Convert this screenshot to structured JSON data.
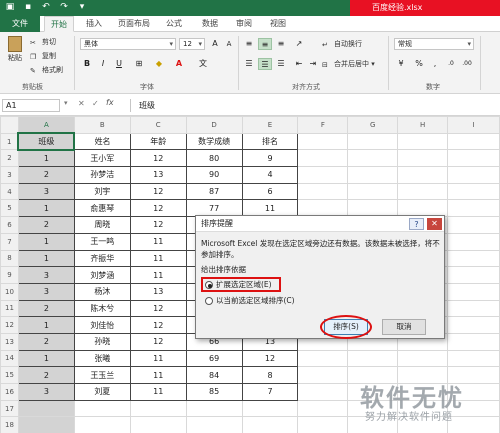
{
  "titlebar": {
    "doc_title": "百度经验.xlsx"
  },
  "tabs": [
    "文件",
    "开始",
    "插入",
    "页面布局",
    "公式",
    "数据",
    "审阅",
    "视图"
  ],
  "ribbon": {
    "clipboard": {
      "paste": "粘贴",
      "cut": "剪切",
      "copy": "复制",
      "format_painter": "格式刷",
      "label": "剪贴板"
    },
    "font": {
      "name": "黑体",
      "size": "12",
      "bold": "B",
      "italic": "I",
      "underline": "U",
      "label": "字体"
    },
    "alignment": {
      "wrap": "自动换行",
      "merge": "合并后居中",
      "label": "对齐方式"
    },
    "number": {
      "format": "常规",
      "label": "数字"
    }
  },
  "formula_bar": {
    "cell_ref": "A1",
    "fx": "fx",
    "content": "班级"
  },
  "columns": [
    "A",
    "B",
    "C",
    "D",
    "E",
    "F",
    "G",
    "H",
    "I"
  ],
  "headers": [
    "班级",
    "姓名",
    "年龄",
    "数学成绩",
    "排名"
  ],
  "rows": [
    [
      "1",
      "王小军",
      "12",
      "80",
      "9"
    ],
    [
      "2",
      "孙梦洁",
      "13",
      "90",
      "4"
    ],
    [
      "3",
      "刘宇",
      "12",
      "87",
      "6"
    ],
    [
      "1",
      "俞惠琴",
      "12",
      "77",
      "11"
    ],
    [
      "2",
      "周晓",
      "12",
      "",
      ""
    ],
    [
      "1",
      "王一鸣",
      "11",
      "",
      ""
    ],
    [
      "1",
      "齐振华",
      "11",
      "",
      ""
    ],
    [
      "3",
      "刘梦涵",
      "11",
      "",
      ""
    ],
    [
      "3",
      "杨沐",
      "13",
      "",
      ""
    ],
    [
      "2",
      "陈木兮",
      "12",
      "",
      ""
    ],
    [
      "1",
      "刘佳怡",
      "12",
      "",
      ""
    ],
    [
      "2",
      "孙晓",
      "12",
      "66",
      "13"
    ],
    [
      "1",
      "张曦",
      "11",
      "69",
      "12"
    ],
    [
      "2",
      "王玉兰",
      "11",
      "84",
      "8"
    ],
    [
      "3",
      "刘夏",
      "11",
      "85",
      "7"
    ]
  ],
  "row_numbers": [
    "1",
    "2",
    "3",
    "4",
    "5",
    "6",
    "7",
    "8",
    "9",
    "10",
    "11",
    "12",
    "13",
    "14",
    "15",
    "16",
    "17",
    "18"
  ],
  "dialog": {
    "title": "排序提醒",
    "help": "?",
    "close": "✕",
    "message": "Microsoft Excel 发现在选定区域旁边还有数据。该数据未被选择，将不参加排序。",
    "group_label": "给出排序依据",
    "option1": "扩展选定区域(E)",
    "option2": "以当前选定区域排序(C)",
    "sort_button": "排序(S)",
    "cancel_button": "取消"
  },
  "watermark": {
    "logo": "软件无忧",
    "sub": "努力解决软件问题"
  },
  "colors": {
    "excel_green": "#217346",
    "title_red": "#e81123",
    "highlight_red": "#dd1111"
  }
}
